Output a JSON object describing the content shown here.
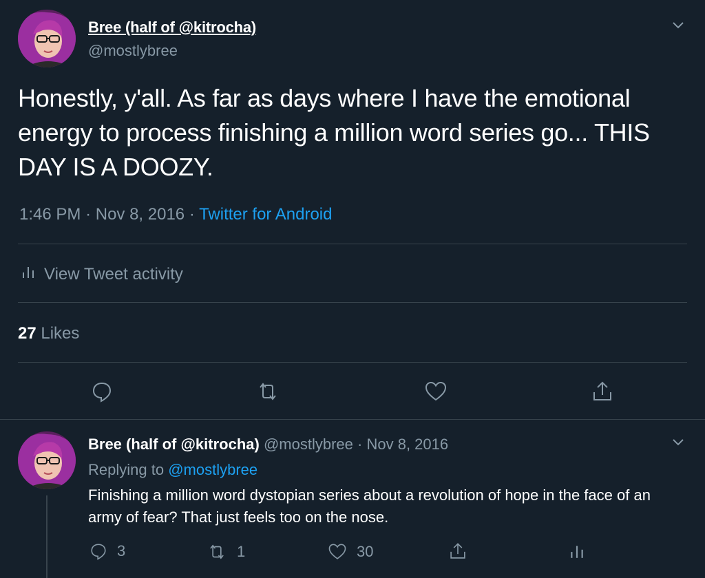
{
  "tweet": {
    "author_name": "Bree (half of @kitrocha)",
    "handle": "@mostlybree",
    "text": "Honestly, y'all. As far as days where I have the emotional energy to process finishing a million word series go... THIS DAY IS A DOOZY.",
    "time": "1:46 PM",
    "date": "Nov 8, 2016",
    "source": "Twitter for Android",
    "activity_label": "View Tweet activity",
    "likes_count": "27",
    "likes_label": "Likes",
    "menu_icon": "chevron-down-icon"
  },
  "reply": {
    "author_name": "Bree (half of @kitrocha)",
    "handle": "@mostlybree",
    "date": "Nov 8, 2016",
    "replying_prefix": "Replying to",
    "replying_to": "@mostlybree",
    "text": "Finishing a million word dystopian series about a revolution of hope in the face of an army of fear? That just feels too on the nose.",
    "reply_count": "3",
    "retweet_count": "1",
    "like_count": "30"
  },
  "colors": {
    "background": "#15202b",
    "muted": "#8899a6",
    "link": "#1da1f2",
    "divider": "#38444d"
  },
  "separators": {
    "dot": "·"
  }
}
